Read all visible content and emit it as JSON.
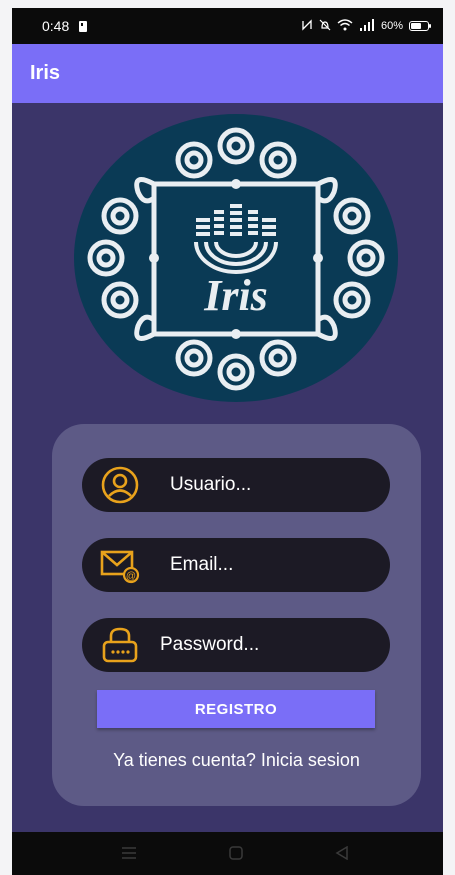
{
  "status_bar": {
    "time": "0:48",
    "battery": "60%",
    "icons": [
      "sim-icon",
      "nfc-icon",
      "mute-icon",
      "wifi-icon",
      "signal-icon",
      "battery-icon"
    ]
  },
  "app_bar": {
    "title": "Iris"
  },
  "logo": {
    "text": "Iris",
    "colors": {
      "circle": "#0a3a55",
      "ornament": "#e9eef2"
    }
  },
  "form": {
    "username_placeholder": "Usuario...",
    "email_placeholder": "Email...",
    "password_placeholder": "Password...",
    "register_label": "REGISTRO",
    "login_link": "Ya tienes cuenta? Inicia sesion"
  },
  "nav_bar": {
    "icons": [
      "menu-icon",
      "home-icon",
      "back-icon"
    ]
  },
  "colors": {
    "accent": "#7a6ef7",
    "background": "#3b3569",
    "card": "#5d5a86",
    "field": "#1c1a25",
    "icon_gold": "#e8a21c"
  }
}
